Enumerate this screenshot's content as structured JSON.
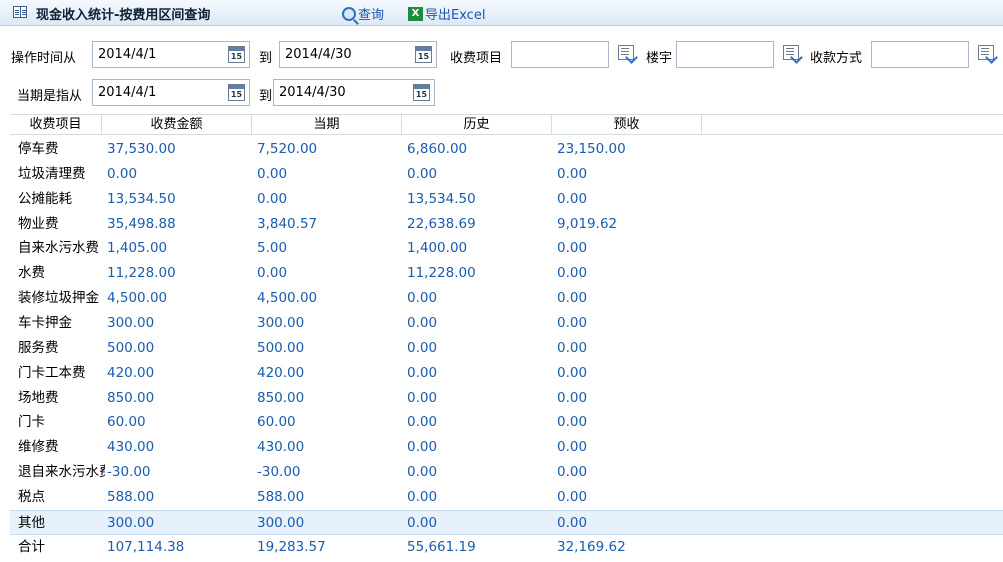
{
  "window": {
    "title": "现金收入统计-按费用区间查询"
  },
  "toolbar": {
    "query_label": "查询",
    "export_label": "导出Excel",
    "excel_icon_text": "X"
  },
  "filters": {
    "op_time_label": "操作时间从",
    "op_from": "2014/4/1",
    "to_label": "到",
    "op_to": "2014/4/30",
    "fee_item_label": "收费项目",
    "fee_item_value": "",
    "building_label": "楼宇",
    "building_value": "",
    "pay_method_label": "收款方式",
    "pay_method_value": "",
    "period_label": "当期是指从",
    "period_from": "2014/4/1",
    "period_to_label": "到",
    "period_to": "2014/4/30",
    "calendar_icon_text": "15"
  },
  "grid": {
    "columns": [
      "收费项目",
      "收费金额",
      "当期",
      "历史",
      "预收"
    ],
    "rows": [
      [
        "停车费",
        "37,530.00",
        "7,520.00",
        "6,860.00",
        "23,150.00"
      ],
      [
        "垃圾清理费",
        "0.00",
        "0.00",
        "0.00",
        "0.00"
      ],
      [
        "公摊能耗",
        "13,534.50",
        "0.00",
        "13,534.50",
        "0.00"
      ],
      [
        "物业费",
        "35,498.88",
        "3,840.57",
        "22,638.69",
        "9,019.62"
      ],
      [
        "自来水污水费",
        "1,405.00",
        "5.00",
        "1,400.00",
        "0.00"
      ],
      [
        "水费",
        "11,228.00",
        "0.00",
        "11,228.00",
        "0.00"
      ],
      [
        "装修垃圾押金",
        "4,500.00",
        "4,500.00",
        "0.00",
        "0.00"
      ],
      [
        "车卡押金",
        "300.00",
        "300.00",
        "0.00",
        "0.00"
      ],
      [
        "服务费",
        "500.00",
        "500.00",
        "0.00",
        "0.00"
      ],
      [
        "门卡工本费",
        "420.00",
        "420.00",
        "0.00",
        "0.00"
      ],
      [
        "场地费",
        "850.00",
        "850.00",
        "0.00",
        "0.00"
      ],
      [
        "门卡",
        "60.00",
        "60.00",
        "0.00",
        "0.00"
      ],
      [
        "维修费",
        "430.00",
        "430.00",
        "0.00",
        "0.00"
      ],
      [
        "退自来水污水费",
        "-30.00",
        "-30.00",
        "0.00",
        "0.00"
      ],
      [
        "税点",
        "588.00",
        "588.00",
        "0.00",
        "0.00"
      ],
      [
        "其他",
        "300.00",
        "300.00",
        "0.00",
        "0.00"
      ],
      [
        "合计",
        "107,114.38",
        "19,283.57",
        "55,661.19",
        "32,169.62"
      ]
    ],
    "selected_row": 15
  }
}
